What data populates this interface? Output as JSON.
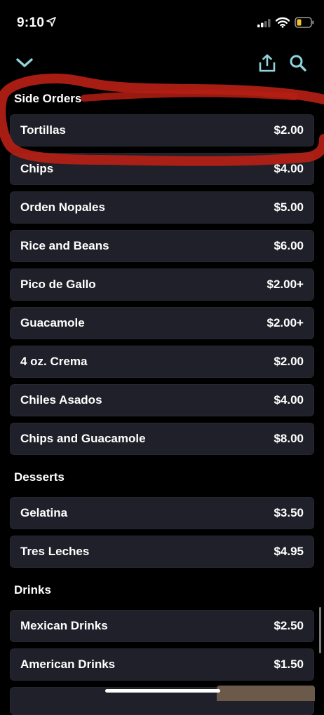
{
  "status": {
    "time": "9:10"
  },
  "nav": {
    "back_icon": "chevron-down-icon",
    "share_icon": "share-icon",
    "search_icon": "search-icon",
    "accent": "#8fd3dc"
  },
  "annotation": {
    "color": "#b51f14"
  },
  "sections": [
    {
      "title": "Side Orders",
      "items": [
        {
          "name": "Tortillas",
          "price": "$2.00"
        },
        {
          "name": "Chips",
          "price": "$4.00"
        },
        {
          "name": "Orden Nopales",
          "price": "$5.00"
        },
        {
          "name": "Rice and Beans",
          "price": "$6.00"
        },
        {
          "name": "Pico de Gallo",
          "price": "$2.00+"
        },
        {
          "name": "Guacamole",
          "price": "$2.00+"
        },
        {
          "name": "4 oz. Crema",
          "price": "$2.00"
        },
        {
          "name": "Chiles Asados",
          "price": "$4.00"
        },
        {
          "name": "Chips and Guacamole",
          "price": "$8.00"
        }
      ]
    },
    {
      "title": "Desserts",
      "items": [
        {
          "name": "Gelatina",
          "price": "$3.50"
        },
        {
          "name": "Tres Leches",
          "price": "$4.95"
        }
      ]
    },
    {
      "title": "Drinks",
      "items": [
        {
          "name": "Mexican Drinks",
          "price": "$2.50"
        },
        {
          "name": "American Drinks",
          "price": "$1.50"
        }
      ]
    }
  ]
}
